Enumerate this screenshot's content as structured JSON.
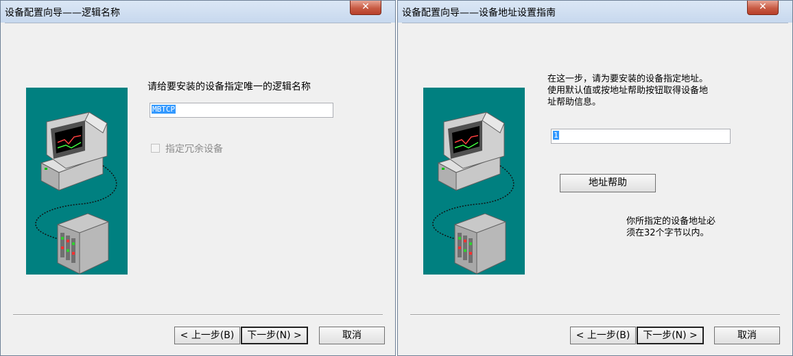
{
  "dialog1": {
    "title": "设备配置向导——逻辑名称",
    "close_glyph": "✕",
    "prompt": "请给要安装的设备指定唯一的逻辑名称",
    "name_value": "MBTCP",
    "redundant_label": "指定冗余设备",
    "back_label": "< 上一步(B)",
    "next_label": "下一步(N) >",
    "cancel_label": "取消"
  },
  "dialog2": {
    "title": "设备配置向导——设备地址设置指南",
    "close_glyph": "✕",
    "instruction_line1": "在这一步，请为要安装的设备指定地址。",
    "instruction_line2": "使用默认值或按地址帮助按钮取得设备地",
    "instruction_line3": "址帮助信息。",
    "address_value": "1",
    "address_help_label": "地址帮助",
    "note_line1": "你所指定的设备地址必",
    "note_line2": "须在32个字节以内。",
    "back_label": "< 上一步(B)",
    "next_label": "下一步(N) >",
    "cancel_label": "取消"
  },
  "icons": [
    "close-icon",
    "computer-illustration",
    "plc-device-illustration"
  ],
  "colors": {
    "art_bg": "#008080",
    "selection": "#3399ff",
    "close_button": "#c75a43"
  }
}
